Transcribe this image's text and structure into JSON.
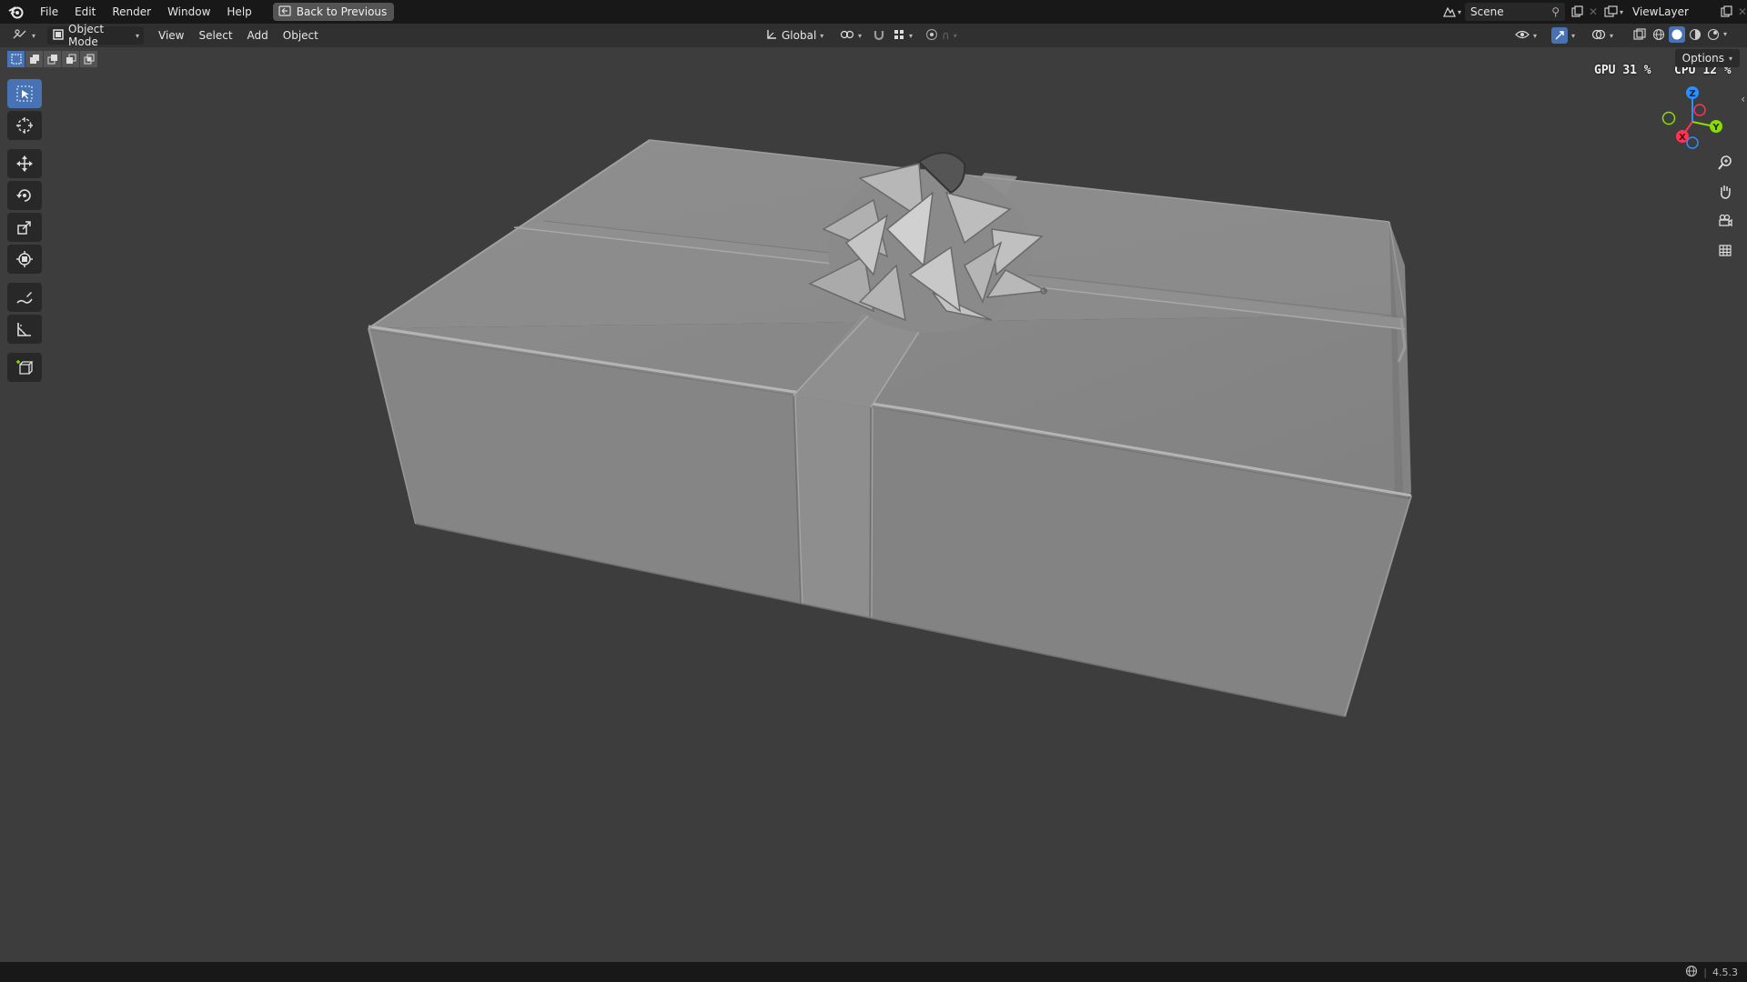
{
  "topbar": {
    "menus": [
      "File",
      "Edit",
      "Render",
      "Window",
      "Help"
    ],
    "back_button": "Back to Previous",
    "scene_name": "Scene",
    "view_layer": "ViewLayer"
  },
  "header": {
    "mode": "Object Mode",
    "menus": [
      "View",
      "Select",
      "Add",
      "Object"
    ],
    "orientation": "Global"
  },
  "viewport": {
    "options_label": "Options",
    "gpu_label": "GPU",
    "gpu_value": "31 %",
    "cpu_label": "CPU",
    "cpu_value": "12 %",
    "gizmo_axes": {
      "x": "X",
      "y": "Y",
      "z": "Z"
    }
  },
  "statusbar": {
    "version": "4.5.3"
  },
  "colors": {
    "accent": "#4772b3",
    "x_axis": "#ff3352",
    "y_axis": "#8bdc00",
    "z_axis": "#2890ff"
  },
  "icons": {
    "toolbar": [
      "select-box-icon",
      "cursor-icon",
      "move-icon",
      "rotate-icon",
      "scale-icon",
      "transform-icon",
      "annotate-icon",
      "measure-icon",
      "add-cube-icon"
    ],
    "nav": [
      "zoom-icon",
      "hand-pan-icon",
      "camera-icon",
      "grid-ortho-icon"
    ]
  }
}
